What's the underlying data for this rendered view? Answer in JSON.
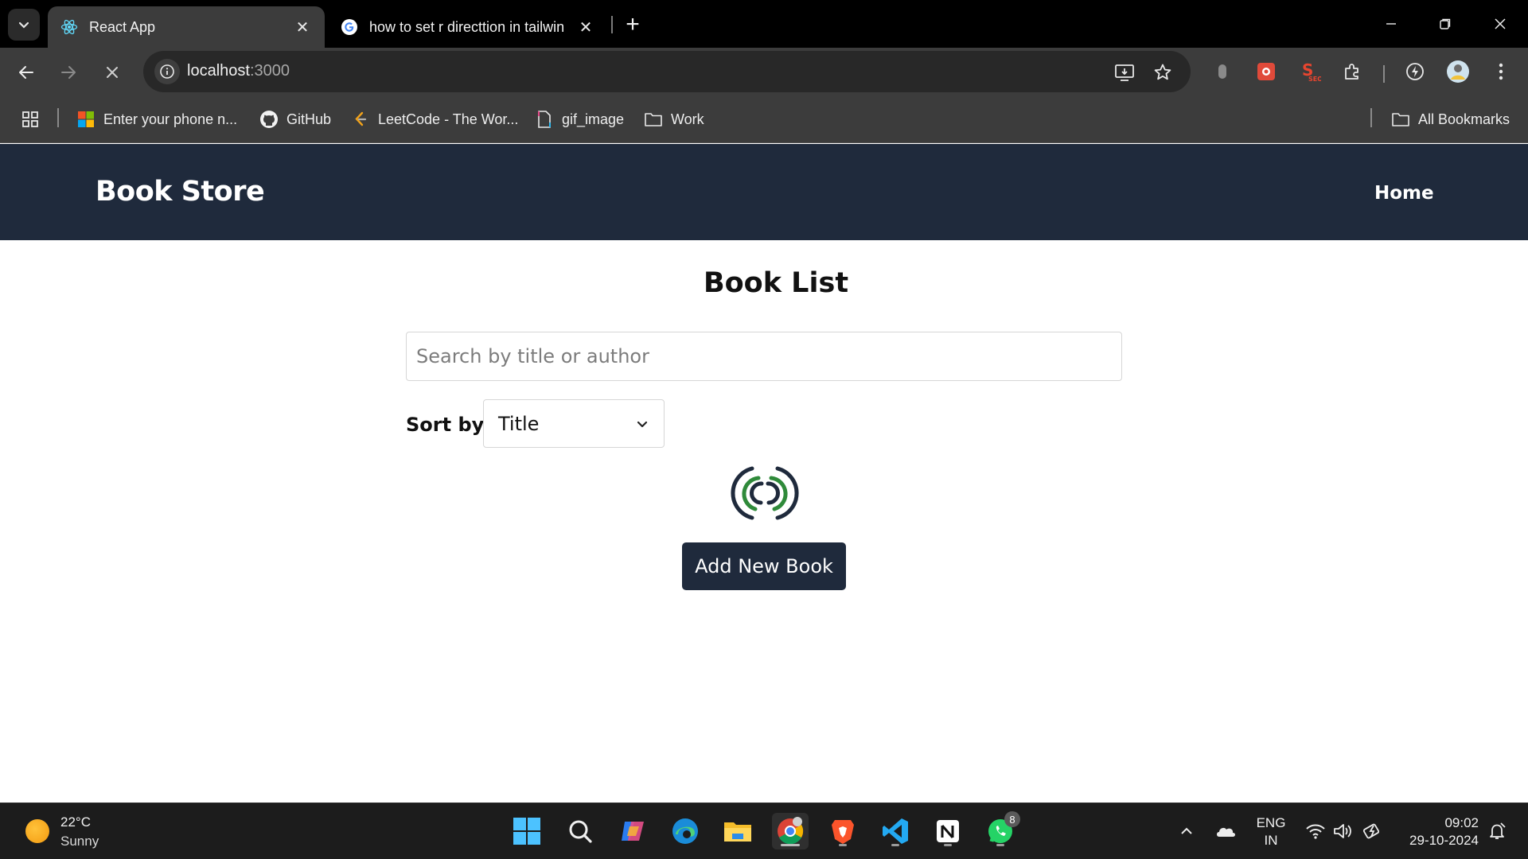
{
  "browser": {
    "tabs": [
      {
        "title": "React App",
        "icon": "react-icon",
        "active": true
      },
      {
        "title": "how to set r directtion in tailwin",
        "icon": "google-icon",
        "active": false
      }
    ],
    "url": {
      "host": "localhost",
      "port": ":3000"
    },
    "bookmarks": [
      {
        "label": "Enter your phone n...",
        "icon": "microsoft-icon"
      },
      {
        "label": "GitHub",
        "icon": "github-icon"
      },
      {
        "label": "LeetCode - The Wor...",
        "icon": "leetcode-icon"
      },
      {
        "label": "gif_image",
        "icon": "file-icon"
      },
      {
        "label": "Work",
        "icon": "folder-icon"
      }
    ],
    "all_bookmarks_label": "All Bookmarks"
  },
  "app": {
    "brand": "Book Store",
    "nav_home": "Home",
    "page_title": "Book List",
    "search_placeholder": "Search by title or author",
    "sort_label": "Sort by:",
    "sort_value": "Title",
    "add_button": "Add New Book",
    "spinner_colors": {
      "dark": "#1f2a3c",
      "green": "#2f8a3a"
    },
    "nav_color": "#1f2a3c"
  },
  "taskbar": {
    "weather": {
      "temp": "22°C",
      "condition": "Sunny"
    },
    "apps": [
      "start-icon",
      "search-icon",
      "copilot-icon",
      "edge-icon",
      "file-explorer-icon",
      "chrome-icon",
      "brave-icon",
      "vscode-icon",
      "notion-icon",
      "whatsapp-icon"
    ],
    "whatsapp_badge": "8",
    "lang": {
      "line1": "ENG",
      "line2": "IN"
    },
    "time": "09:02",
    "date": "29-10-2024"
  }
}
